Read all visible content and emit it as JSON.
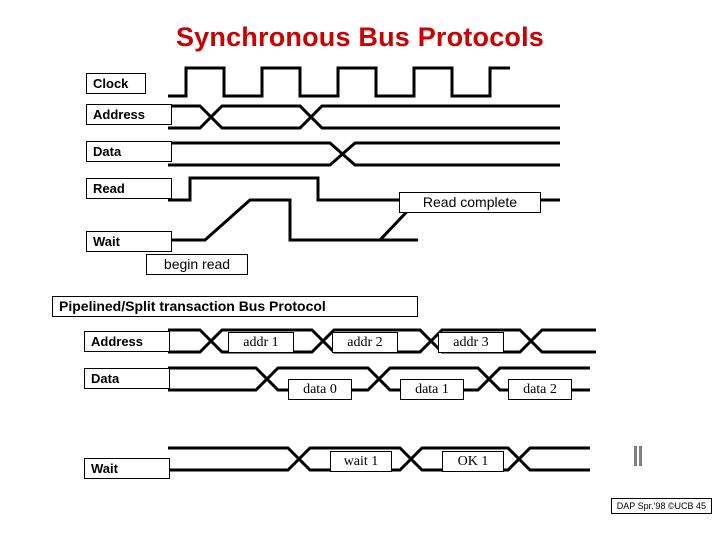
{
  "title": "Synchronous Bus Protocols",
  "top_diagram": {
    "signals": [
      {
        "label": "Clock"
      },
      {
        "label": "Address"
      },
      {
        "label": "Data"
      },
      {
        "label": "Read"
      },
      {
        "label": "Wait"
      }
    ],
    "annotations": [
      {
        "label": "Read complete"
      },
      {
        "label": "begin read"
      }
    ]
  },
  "bottom_diagram": {
    "heading": "Pipelined/Split transaction Bus Protocol",
    "signals": [
      {
        "label": "Address"
      },
      {
        "label": "Data"
      },
      {
        "label": "Wait"
      }
    ],
    "address_values": [
      "addr 1",
      "addr 2",
      "addr 3"
    ],
    "data_values": [
      "data 0",
      "data 1",
      "data 2"
    ],
    "wait_values": [
      "wait 1",
      "OK 1"
    ]
  },
  "footer": "DAP Spr.'98 ©UCB 45",
  "colors": {
    "title": "#cc0000",
    "wave": "#000000",
    "background": "#ffffff"
  }
}
